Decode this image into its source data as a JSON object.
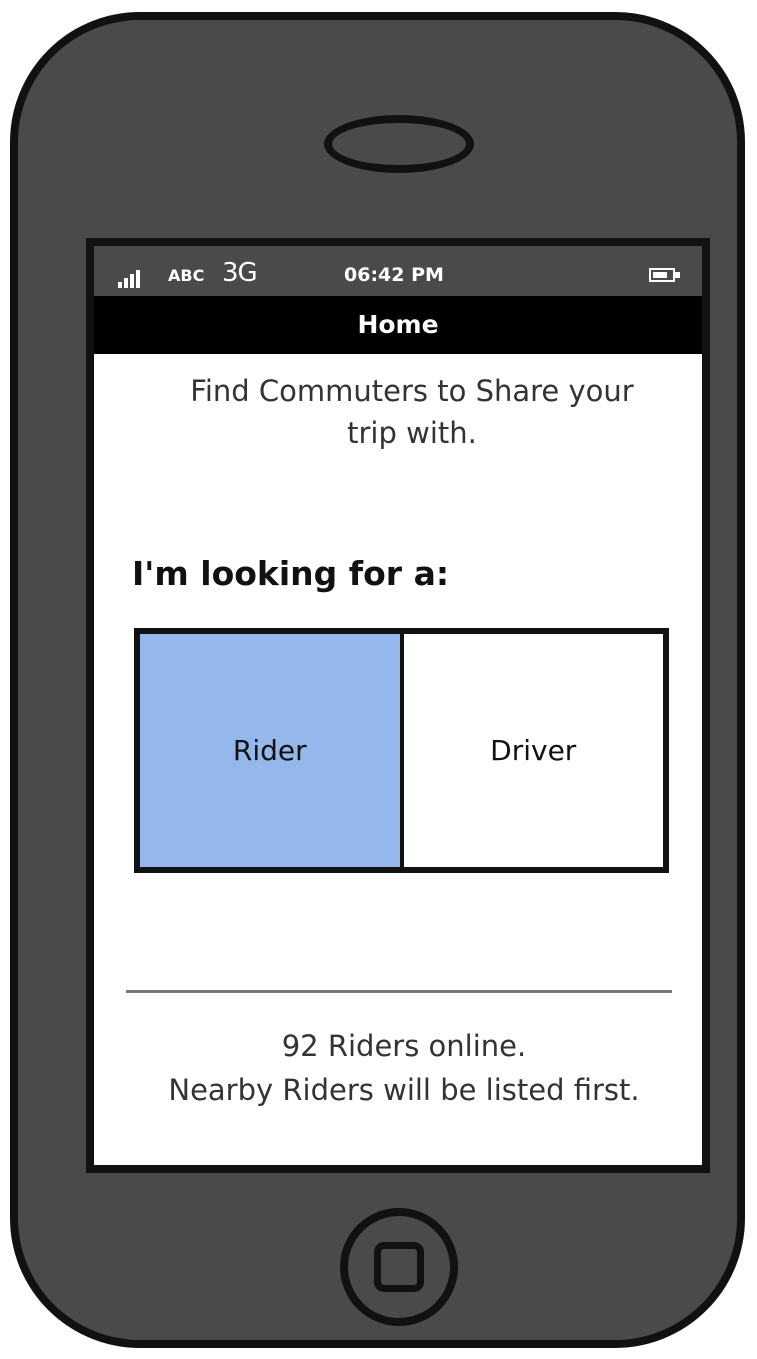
{
  "status_bar": {
    "carrier": "ABC",
    "network": "3G",
    "time": "06:42 PM",
    "signal_icon": "signal-bars-icon",
    "battery_icon": "battery-icon"
  },
  "nav": {
    "title": "Home"
  },
  "main": {
    "intro_line1": "Find Commuters to Share your",
    "intro_line2": "trip with.",
    "looking_label": "I'm looking for a:",
    "segments": [
      {
        "label": "Rider",
        "selected": true
      },
      {
        "label": "Driver",
        "selected": false
      }
    ],
    "online_line1": "92 Riders online.",
    "online_line2": "Nearby Riders will be listed first."
  },
  "colors": {
    "selected_segment": "#95b8ec",
    "phone_body": "#4a4a4a",
    "nav_bar": "#000000"
  }
}
